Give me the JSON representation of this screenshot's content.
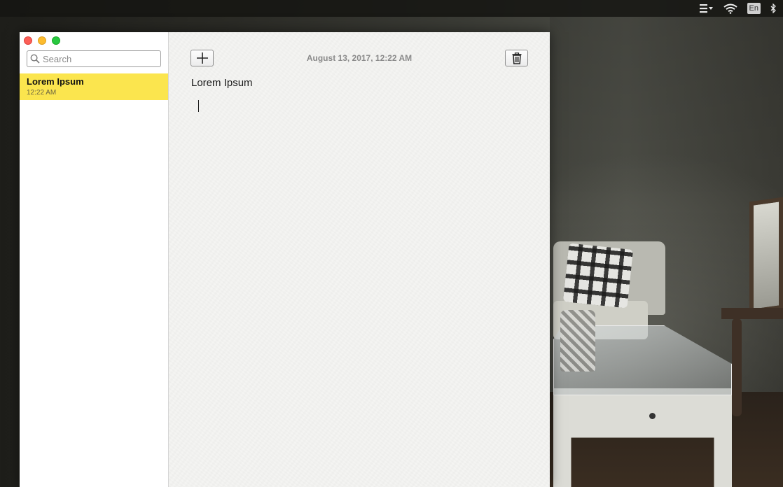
{
  "menubar": {
    "icons": [
      "list-menu-icon",
      "wifi-icon",
      "input-language-icon",
      "bluetooth-icon"
    ],
    "language": "En"
  },
  "sidebar": {
    "search": {
      "placeholder": "Search",
      "value": ""
    },
    "notes": [
      {
        "title": "Lorem Ipsum",
        "time": "12:22 AM",
        "selected": true
      }
    ]
  },
  "editor": {
    "date": "August 13, 2017, 12:22 AM",
    "title": "Lorem Ipsum",
    "body": ""
  },
  "colors": {
    "selected_note": "#fbe54e",
    "traffic_close": "#fc5f57",
    "traffic_minimize": "#fdbc2e",
    "traffic_zoom": "#28c840"
  }
}
